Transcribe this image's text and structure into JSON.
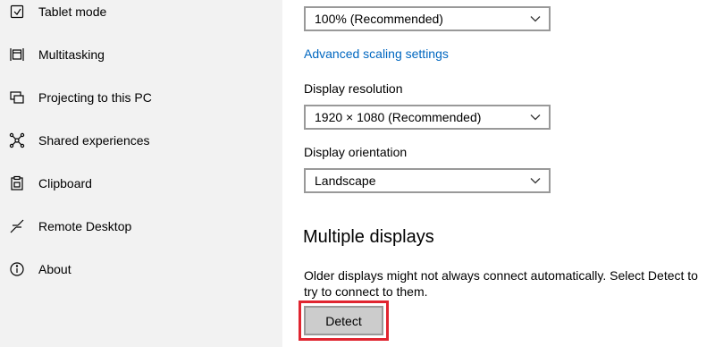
{
  "sidebar": {
    "items": [
      {
        "label": "Tablet mode",
        "icon": "tablet-mode-icon"
      },
      {
        "label": "Multitasking",
        "icon": "multitasking-icon"
      },
      {
        "label": "Projecting to this PC",
        "icon": "projecting-icon"
      },
      {
        "label": "Shared experiences",
        "icon": "shared-experiences-icon"
      },
      {
        "label": "Clipboard",
        "icon": "clipboard-icon"
      },
      {
        "label": "Remote Desktop",
        "icon": "remote-desktop-icon"
      },
      {
        "label": "About",
        "icon": "about-icon"
      }
    ]
  },
  "main": {
    "scale_dropdown": {
      "value": "100% (Recommended)"
    },
    "advanced_scaling_link": "Advanced scaling settings",
    "resolution": {
      "label": "Display resolution",
      "value": "1920 × 1080 (Recommended)"
    },
    "orientation": {
      "label": "Display orientation",
      "value": "Landscape"
    },
    "multiple_displays": {
      "title": "Multiple displays",
      "description": "Older displays might not always connect automatically. Select Detect to try to connect to them.",
      "detect_label": "Detect"
    }
  },
  "colors": {
    "sidebar_bg": "#f2f2f2",
    "link": "#0067c0",
    "highlight": "#e02530",
    "button_bg": "#cccccc"
  }
}
